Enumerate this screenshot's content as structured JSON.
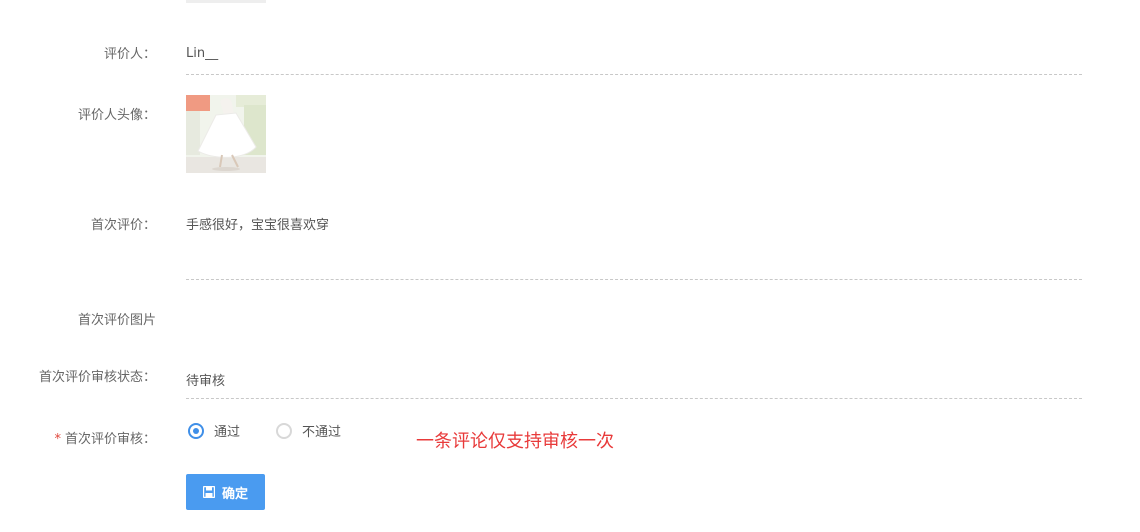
{
  "form": {
    "reviewer_label": "评价人：",
    "reviewer_value": "Lin__",
    "avatar_label": "评价人头像：",
    "first_review_label": "首次评价：",
    "first_review_value": "手感很好，宝宝很喜欢穿",
    "first_review_images_label": "首次评价图片",
    "audit_status_label": "首次评价审核状态：",
    "audit_status_value": "待审核",
    "audit_required_star": "*",
    "audit_label": "首次评价审核：",
    "audit_options": [
      {
        "label": "通过",
        "checked": true
      },
      {
        "label": "不通过",
        "checked": false
      }
    ],
    "notice": "一条评论仅支持审核一次",
    "confirm_label": "确定",
    "confirm_icon": "save-icon"
  },
  "colors": {
    "accent": "#3f8fe8",
    "button": "#4a9bf0",
    "notice": "#e83a3a",
    "required": "#e0463a"
  }
}
